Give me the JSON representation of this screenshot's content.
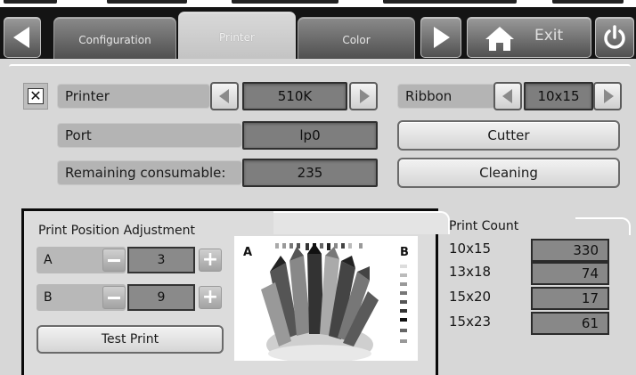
{
  "tabs": [
    {
      "label": "Configuration",
      "active": false
    },
    {
      "label": "Printer",
      "active": true
    },
    {
      "label": "Color",
      "active": false
    }
  ],
  "toolbar": {
    "exit_label": "Exit"
  },
  "printer": {
    "checkbox_mark": "✕",
    "printer_label": "Printer",
    "printer_value": "510K",
    "port_label": "Port",
    "port_value": "lp0",
    "remaining_label": "Remaining consumable:",
    "remaining_value": "235",
    "ribbon_label": "Ribbon",
    "ribbon_value": "10x15",
    "cutter_label": "Cutter",
    "cleaning_label": "Cleaning"
  },
  "adjustment": {
    "title": "Print Position Adjustment",
    "a_label": "A",
    "a_value": "3",
    "b_label": "B",
    "b_value": "9",
    "test_print_label": "Test Print",
    "preview_marker_a": "A",
    "preview_marker_b": "B"
  },
  "print_count": {
    "title": "Print Count",
    "rows": [
      {
        "size": "10x15",
        "count": "330"
      },
      {
        "size": "13x18",
        "count": "74"
      },
      {
        "size": "15x20",
        "count": "17"
      },
      {
        "size": "15x23",
        "count": "61"
      }
    ]
  },
  "icons": {
    "back": "left-arrow-icon",
    "forward": "right-arrow-icon",
    "home": "home-icon",
    "power": "power-icon"
  },
  "colors": {
    "topbar": "#141414",
    "panel": "#d7d7d7",
    "value_box": "#7e7e7e"
  }
}
